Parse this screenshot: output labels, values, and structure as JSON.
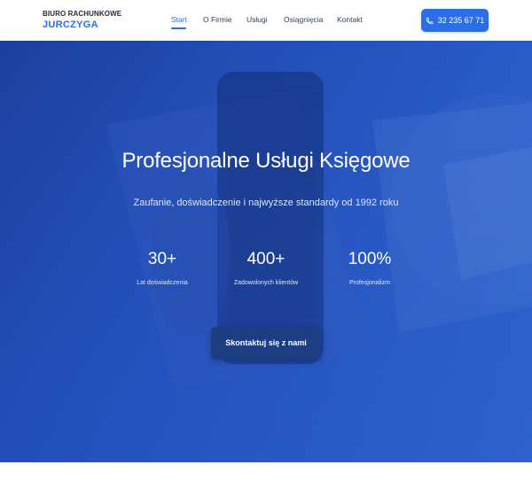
{
  "header": {
    "logo_top": "BIURO RACHUNKOWE",
    "logo_bottom": "JURCZYGA",
    "nav": [
      {
        "label": "Start",
        "active": true
      },
      {
        "label": "O Firmie",
        "active": false
      },
      {
        "label": "Usługi",
        "active": false
      },
      {
        "label": "Osiągnięcia",
        "active": false
      },
      {
        "label": "Kontakt",
        "active": false
      }
    ],
    "phone_label": "32 235 67 71",
    "phone_icon": "phone-icon"
  },
  "hero": {
    "title": "Profesjonalne Usługi Księgowe",
    "subtitle": "Zaufanie, doświadczenie i najwyższe standardy od 1992 roku",
    "stats": [
      {
        "value": "30+",
        "label": "Lat doświadczenia"
      },
      {
        "value": "400+",
        "label": "Zadowolonych klientów"
      },
      {
        "value": "100%",
        "label": "Profesjonalizm"
      }
    ],
    "cta_label": "Skontaktuj się z nami"
  },
  "colors": {
    "accent": "#2b6ee6",
    "hero_dark": "#1b3f9e",
    "cta_bg": "#1c3d82"
  }
}
